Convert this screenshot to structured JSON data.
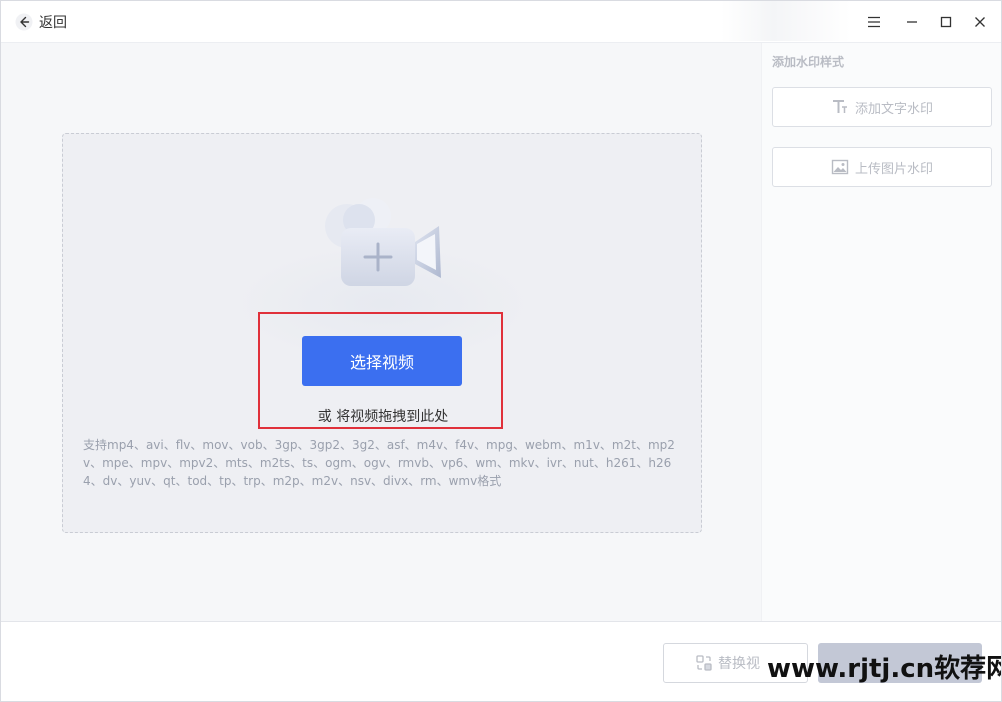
{
  "titlebar": {
    "back_label": "返回"
  },
  "main": {
    "select_button_label": "选择视频",
    "drag_hint": "或 将视频拖拽到此处",
    "formats_text": "支持mp4、avi、flv、mov、vob、3gp、3gp2、3g2、asf、m4v、f4v、mpg、webm、m1v、m2t、mp2v、mpe、mpv、mpv2、mts、m2ts、ts、ogm、ogv、rmvb、vp6、wm、mkv、ivr、nut、h261、h264、dv、yuv、qt、tod、tp、trp、m2p、m2v、nsv、divx、rm、wmv格式"
  },
  "sidepanel": {
    "title": "添加水印样式",
    "add_text_label": "添加文字水印",
    "upload_image_label": "上传图片水印"
  },
  "bottombar": {
    "replace_label": "替换视",
    "site_watermark": "www.rjtj.cn软荐网"
  },
  "colors": {
    "accent": "#3b6ff0",
    "highlight_border": "#e0303a",
    "disabled_text": "#b9bcc4",
    "disabled_button": "#c3c8d6"
  },
  "icons": {
    "back": "arrow-left-icon",
    "menu": "hamburger-menu-icon",
    "minimize": "minimize-icon",
    "maximize": "maximize-icon",
    "close": "close-icon",
    "camera": "video-camera-add-icon",
    "text_watermark": "text-t-icon",
    "image_watermark": "image-icon",
    "replace": "replace-icon"
  }
}
